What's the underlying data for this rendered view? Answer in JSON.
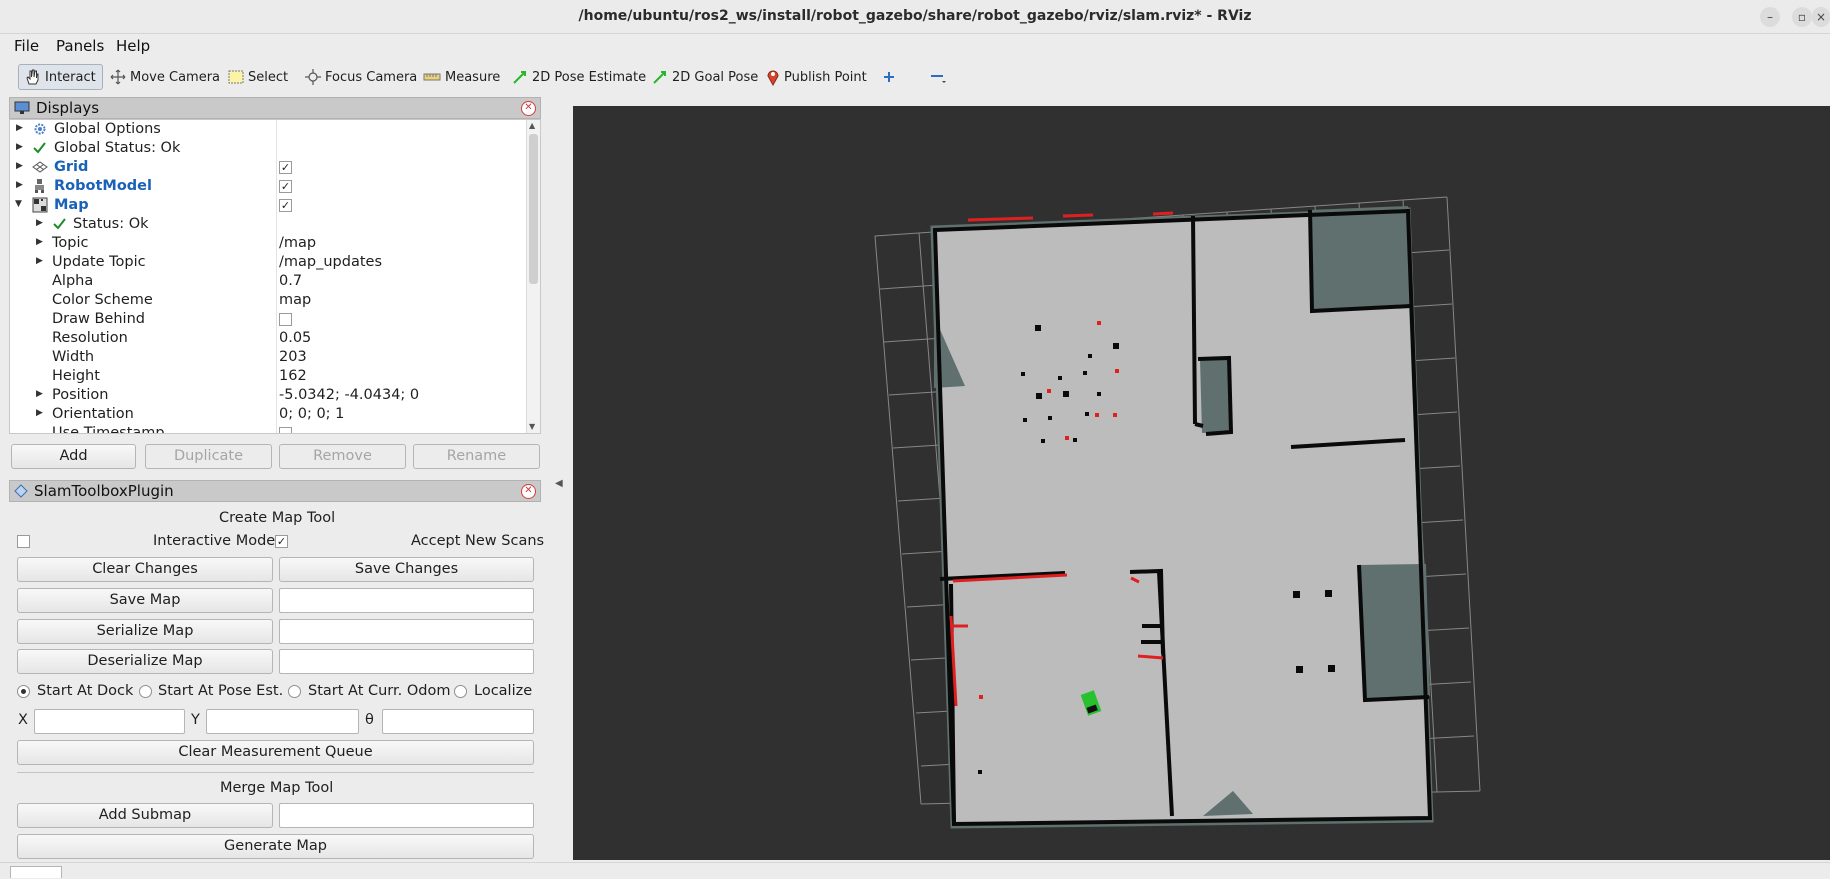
{
  "window": {
    "title": "/home/ubuntu/ros2_ws/install/robot_gazebo/share/robot_gazebo/rviz/slam.rviz* - RViz"
  },
  "menu": [
    "File",
    "Panels",
    "Help"
  ],
  "toolbar": {
    "interact": "Interact",
    "move_camera": "Move Camera",
    "select": "Select",
    "focus_camera": "Focus Camera",
    "measure": "Measure",
    "pose_estimate": "2D Pose Estimate",
    "goal_pose": "2D Goal Pose",
    "publish_point": "Publish Point"
  },
  "displays": {
    "title": "Displays",
    "items": [
      {
        "label": "Global Options"
      },
      {
        "label": "Global Status: Ok"
      },
      {
        "label": "Grid",
        "checked": true
      },
      {
        "label": "RobotModel",
        "checked": true
      },
      {
        "label": "Map",
        "checked": true
      }
    ],
    "map_props": [
      {
        "label": "Status: Ok",
        "value": ""
      },
      {
        "label": "Topic",
        "value": "/map"
      },
      {
        "label": "Update Topic",
        "value": "/map_updates"
      },
      {
        "label": "Alpha",
        "value": "0.7"
      },
      {
        "label": "Color Scheme",
        "value": "map"
      },
      {
        "label": "Draw Behind",
        "value": ""
      },
      {
        "label": "Resolution",
        "value": "0.05"
      },
      {
        "label": "Width",
        "value": "203"
      },
      {
        "label": "Height",
        "value": "162"
      },
      {
        "label": "Position",
        "value": "-5.0342; -4.0434; 0"
      },
      {
        "label": "Orientation",
        "value": "0; 0; 0; 1"
      },
      {
        "label": "Use Timestamp",
        "value": ""
      }
    ],
    "buttons": {
      "add": "Add",
      "duplicate": "Duplicate",
      "remove": "Remove",
      "rename": "Rename"
    }
  },
  "slam": {
    "title": "SlamToolboxPlugin",
    "create_map_tool": "Create Map Tool",
    "interactive_mode": "Interactive Mode",
    "accept_new_scans": "Accept New Scans",
    "clear_changes": "Clear Changes",
    "save_changes": "Save Changes",
    "save_map": "Save Map",
    "serialize_map": "Serialize Map",
    "deserialize_map": "Deserialize Map",
    "start_at_dock": "Start At Dock",
    "start_at_pose_est": "Start At Pose Est.",
    "start_at_curr_odom": "Start At Curr. Odom",
    "localize": "Localize",
    "x_label": "X",
    "y_label": "Y",
    "theta_label": "θ",
    "clear_measurement_queue": "Clear Measurement Queue",
    "merge_map_tool": "Merge Map Tool",
    "add_submap": "Add Submap",
    "generate_map": "Generate Map"
  },
  "colors": {
    "viewport_bg": "#303030",
    "map_free": "#bcbcbc",
    "map_unknown": "#5f706f",
    "map_wall": "#0a0a0a",
    "laser_scan": "#e02020",
    "robot": "#29c22f"
  }
}
